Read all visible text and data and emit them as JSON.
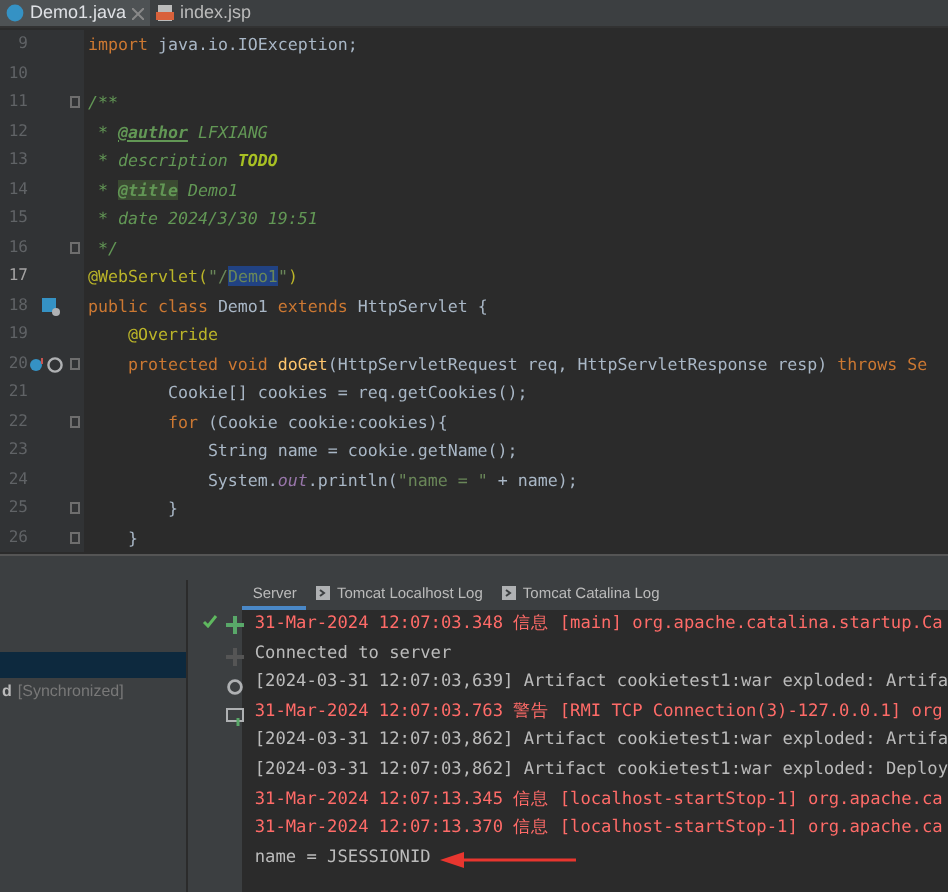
{
  "editor": {
    "tabs": [
      {
        "label": "Demo1.java",
        "kind": "java",
        "selected": true,
        "closable": true
      },
      {
        "label": "index.jsp",
        "kind": "jsp",
        "selected": false,
        "closable": false
      }
    ],
    "lines": [
      {
        "number": "9",
        "current": false,
        "fold": false,
        "tokens": [
          {
            "text": "import ",
            "kind": "kw"
          },
          {
            "text": "java.io.IOException;",
            "kind": "plain"
          }
        ]
      },
      {
        "number": "10",
        "current": false,
        "fold": false
      },
      {
        "number": "11",
        "current": false,
        "fold": true,
        "tokens": [
          {
            "text": "/**",
            "kind": "comment"
          }
        ]
      },
      {
        "number": "12",
        "current": false,
        "fold": false,
        "tokens": [
          {
            "text": " * ",
            "kind": "comment"
          },
          {
            "text": "@author",
            "kind": "doctag"
          },
          {
            "text": " LFXIANG",
            "kind": "comment"
          }
        ]
      },
      {
        "number": "13",
        "current": false,
        "fold": false,
        "tokens": [
          {
            "text": " * description ",
            "kind": "comment"
          },
          {
            "text": "TODO",
            "kind": "todo"
          }
        ]
      },
      {
        "number": "14",
        "current": false,
        "fold": false,
        "tokens": [
          {
            "text": " * ",
            "kind": "comment"
          },
          {
            "text": "@title",
            "kind": "doctag-marked"
          },
          {
            "text": " Demo1",
            "kind": "comment"
          }
        ]
      },
      {
        "number": "15",
        "current": false,
        "fold": false,
        "tokens": [
          {
            "text": " * date 2024/3/30 19:51",
            "kind": "comment"
          }
        ]
      },
      {
        "number": "16",
        "current": false,
        "fold": true,
        "tokens": [
          {
            "text": " */",
            "kind": "comment"
          }
        ]
      },
      {
        "number": "17",
        "current": true,
        "fold": false,
        "tokens": [
          {
            "text": "@WebServlet(",
            "kind": "annotation"
          },
          {
            "text": "\"/",
            "kind": "string"
          },
          {
            "text": "Demo1",
            "kind": "string-selected"
          },
          {
            "text": "\"",
            "kind": "string"
          },
          {
            "text": ")",
            "kind": "annotation"
          }
        ]
      },
      {
        "number": "18",
        "current": false,
        "fold": false,
        "kind": "servlet",
        "tokens": [
          {
            "text": "public class ",
            "kind": "kw"
          },
          {
            "text": "Demo1 ",
            "kind": "plain"
          },
          {
            "text": "extends ",
            "kind": "kw"
          },
          {
            "text": "HttpServlet {",
            "kind": "plain"
          }
        ]
      },
      {
        "number": "19",
        "current": false,
        "fold": false,
        "tokens": [
          {
            "text": "    @Override",
            "kind": "annotation"
          }
        ]
      },
      {
        "number": "20",
        "current": false,
        "fold": true,
        "kind": "override",
        "tokens": [
          {
            "text": "    protected void ",
            "kind": "kw"
          },
          {
            "text": "doGet",
            "kind": "method"
          },
          {
            "text": "(HttpServletRequest req, HttpServletResponse resp) ",
            "kind": "plain"
          },
          {
            "text": "throws Se",
            "kind": "kw"
          }
        ]
      },
      {
        "number": "21",
        "current": false,
        "fold": false,
        "tokens": [
          {
            "text": "        Cookie[] cookies = req.getCookies();",
            "kind": "plain"
          }
        ]
      },
      {
        "number": "22",
        "current": false,
        "fold": true,
        "tokens": [
          {
            "text": "        for ",
            "kind": "kw"
          },
          {
            "text": "(Cookie cookie:cookies){",
            "kind": "plain"
          }
        ]
      },
      {
        "number": "23",
        "current": false,
        "fold": false,
        "tokens": [
          {
            "text": "            String name = cookie.getName();",
            "kind": "plain"
          }
        ]
      },
      {
        "number": "24",
        "current": false,
        "fold": false,
        "tokens": [
          {
            "text": "            System.",
            "kind": "plain"
          },
          {
            "text": "out",
            "kind": "field"
          },
          {
            "text": ".println(",
            "kind": "plain"
          },
          {
            "text": "\"name = \"",
            "kind": "string"
          },
          {
            "text": " + name);",
            "kind": "plain"
          }
        ]
      },
      {
        "number": "25",
        "current": false,
        "fold": true,
        "tokens": [
          {
            "text": "        }",
            "kind": "plain"
          }
        ]
      },
      {
        "number": "26",
        "current": false,
        "fold": true,
        "tokens": [
          {
            "text": "    }",
            "kind": "plain"
          }
        ]
      }
    ]
  },
  "services": {
    "items": [
      {
        "selected": true
      },
      {
        "label": "d",
        "note": "[Synchronized]",
        "selected": false
      }
    ]
  },
  "console": {
    "tabs": [
      {
        "label": "Server",
        "selected": true,
        "log_icon": false
      },
      {
        "label": "Tomcat Localhost Log",
        "selected": false,
        "log_icon": true
      },
      {
        "label": "Tomcat Catalina Log",
        "selected": false,
        "log_icon": true
      }
    ],
    "lines": [
      {
        "text": "31-Mar-2024 12:07:03.348 信息 [main] org.apache.catalina.startup.Ca",
        "kind": "error"
      },
      {
        "text": "Connected to server",
        "kind": "normal"
      },
      {
        "text": "[2024-03-31 12:07:03,639] Artifact cookietest1:war exploded: Artifa",
        "kind": "normal"
      },
      {
        "text": "31-Mar-2024 12:07:03.763 警告 [RMI TCP Connection(3)-127.0.0.1] org",
        "kind": "error"
      },
      {
        "text": "[2024-03-31 12:07:03,862] Artifact cookietest1:war exploded: Artifa",
        "kind": "normal"
      },
      {
        "text": "[2024-03-31 12:07:03,862] Artifact cookietest1:war exploded: Deploy",
        "kind": "normal"
      },
      {
        "text": "31-Mar-2024 12:07:13.345 信息 [localhost-startStop-1] org.apache.ca",
        "kind": "error"
      },
      {
        "text": "31-Mar-2024 12:07:13.370 信息 [localhost-startStop-1] org.apache.ca",
        "kind": "error"
      },
      {
        "text": "name = JSESSIONID",
        "kind": "normal"
      }
    ]
  }
}
